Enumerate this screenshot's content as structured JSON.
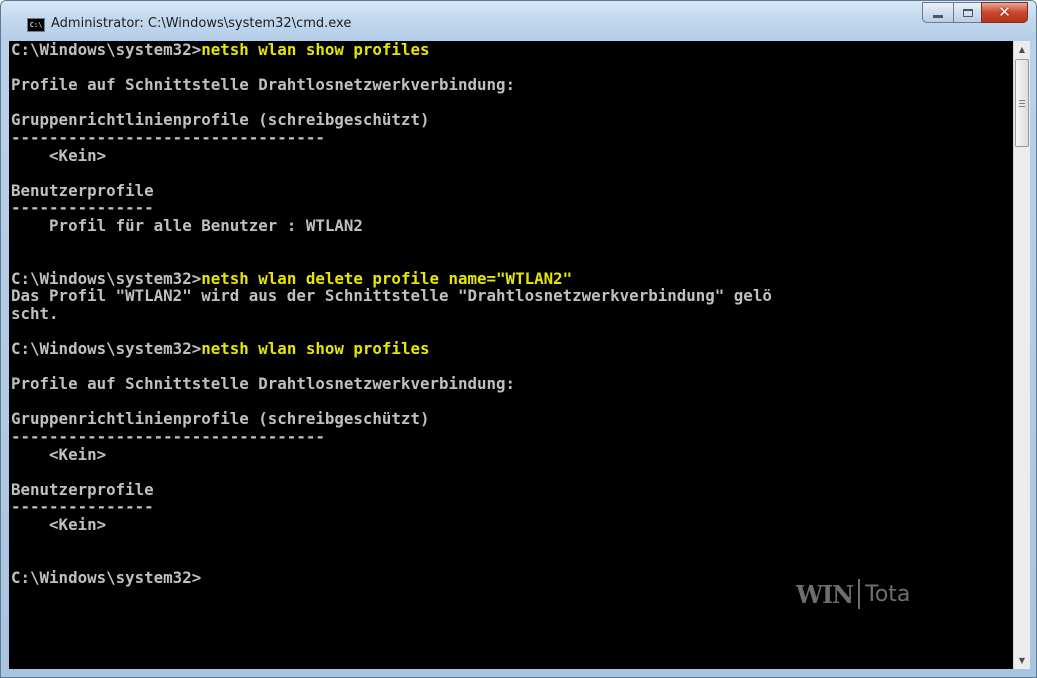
{
  "window": {
    "title": "Administrator: C:\\Windows\\system32\\cmd.exe",
    "icon_text": "C:\\"
  },
  "console": {
    "lines": [
      {
        "text": "C:\\Windows\\system32>",
        "command": "netsh wlan show profiles"
      },
      {
        "text": ""
      },
      {
        "text": "Profile auf Schnittstelle Drahtlosnetzwerkverbindung:"
      },
      {
        "text": ""
      },
      {
        "text": "Gruppenrichtlinienprofile (schreibgeschützt)"
      },
      {
        "text": "---------------------------------"
      },
      {
        "text": "    <Kein>"
      },
      {
        "text": ""
      },
      {
        "text": "Benutzerprofile"
      },
      {
        "text": "---------------"
      },
      {
        "text": "    Profil für alle Benutzer : WTLAN2"
      },
      {
        "text": ""
      },
      {
        "text": ""
      },
      {
        "text": "C:\\Windows\\system32>",
        "command": "netsh wlan delete profile name=\"WTLAN2\""
      },
      {
        "text": "Das Profil \"WTLAN2\" wird aus der Schnittstelle \"Drahtlosnetzwerkverbindung\" gelö"
      },
      {
        "text": "scht."
      },
      {
        "text": ""
      },
      {
        "text": "C:\\Windows\\system32>",
        "command": "netsh wlan show profiles"
      },
      {
        "text": ""
      },
      {
        "text": "Profile auf Schnittstelle Drahtlosnetzwerkverbindung:"
      },
      {
        "text": ""
      },
      {
        "text": "Gruppenrichtlinienprofile (schreibgeschützt)"
      },
      {
        "text": "---------------------------------"
      },
      {
        "text": "    <Kein>"
      },
      {
        "text": ""
      },
      {
        "text": "Benutzerprofile"
      },
      {
        "text": "---------------"
      },
      {
        "text": "    <Kein>"
      },
      {
        "text": ""
      },
      {
        "text": ""
      },
      {
        "text": "C:\\Windows\\system32>"
      }
    ]
  },
  "watermark": {
    "part1": "WIN",
    "part2": "Tota"
  },
  "colors": {
    "console_bg": "#000000",
    "console_text": "#c0c0c0",
    "command_text": "#e6e600"
  }
}
